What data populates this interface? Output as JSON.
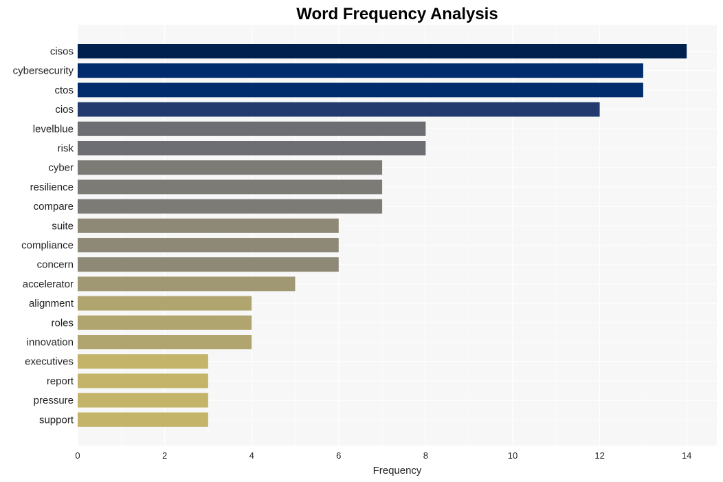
{
  "chart_data": {
    "type": "bar",
    "orientation": "horizontal",
    "title": "Word Frequency Analysis",
    "xlabel": "Frequency",
    "ylabel": "",
    "xlim": [
      0,
      14.7
    ],
    "xticks": [
      0,
      2,
      4,
      6,
      8,
      10,
      12,
      14
    ],
    "grid": true,
    "legend": "none",
    "categories": [
      "cisos",
      "cybersecurity",
      "ctos",
      "cios",
      "levelblue",
      "risk",
      "cyber",
      "resilience",
      "compare",
      "suite",
      "compliance",
      "concern",
      "accelerator",
      "alignment",
      "roles",
      "innovation",
      "executives",
      "report",
      "pressure",
      "support"
    ],
    "values": [
      14,
      13,
      13,
      12,
      8,
      8,
      7,
      7,
      7,
      6,
      6,
      6,
      5,
      4,
      4,
      4,
      3,
      3,
      3,
      3
    ],
    "colors": [
      "#00204e",
      "#002c6d",
      "#002c6d",
      "#223a6e",
      "#6d6e73",
      "#6d6e73",
      "#7d7b76",
      "#7d7b76",
      "#7d7b76",
      "#8e8976",
      "#8e8976",
      "#8e8976",
      "#a09873",
      "#b1a56f",
      "#b1a56f",
      "#b1a56f",
      "#c4b46a",
      "#c4b46a",
      "#c4b46a",
      "#c4b46a"
    ]
  }
}
